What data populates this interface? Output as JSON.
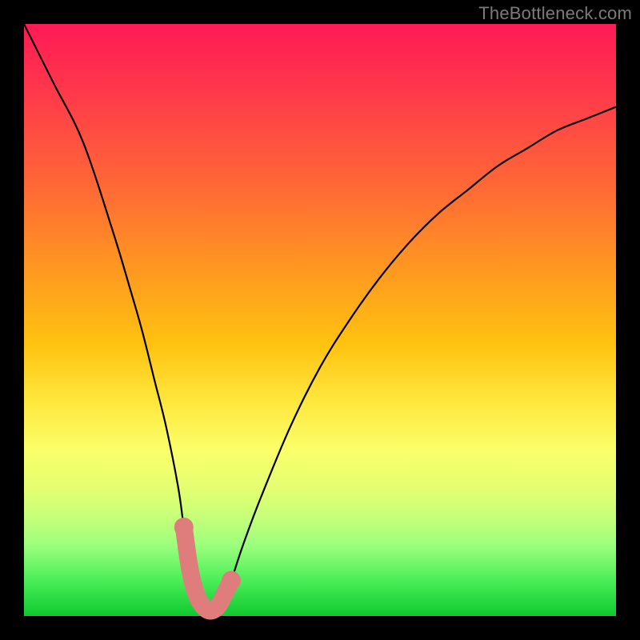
{
  "watermark": "TheBottleneck.com",
  "chart_data": {
    "type": "line",
    "title": "",
    "xlabel": "",
    "ylabel": "",
    "xlim": [
      0,
      100
    ],
    "ylim": [
      0,
      100
    ],
    "grid": false,
    "legend": false,
    "series": [
      {
        "name": "mismatch-curve",
        "x": [
          0,
          5,
          10,
          15,
          18,
          20,
          22,
          24,
          26,
          27,
          28,
          29,
          30,
          31,
          32,
          33,
          34,
          35,
          37,
          40,
          45,
          50,
          55,
          60,
          65,
          70,
          75,
          80,
          85,
          90,
          95,
          100
        ],
        "values": [
          100,
          90,
          80,
          65,
          55,
          48,
          40,
          32,
          22,
          15,
          8,
          4,
          2,
          1,
          1,
          2,
          4,
          6,
          12,
          20,
          32,
          42,
          50,
          57,
          63,
          68,
          72,
          76,
          79,
          82,
          84,
          86
        ]
      },
      {
        "name": "highlight-range",
        "x": [
          27,
          28,
          29,
          30,
          31,
          32,
          33,
          34,
          35
        ],
        "values": [
          15,
          8,
          4,
          2,
          1,
          1,
          2,
          4,
          6
        ]
      }
    ]
  },
  "colors": {
    "curve": "#000000",
    "highlight": "#df7d7d"
  }
}
